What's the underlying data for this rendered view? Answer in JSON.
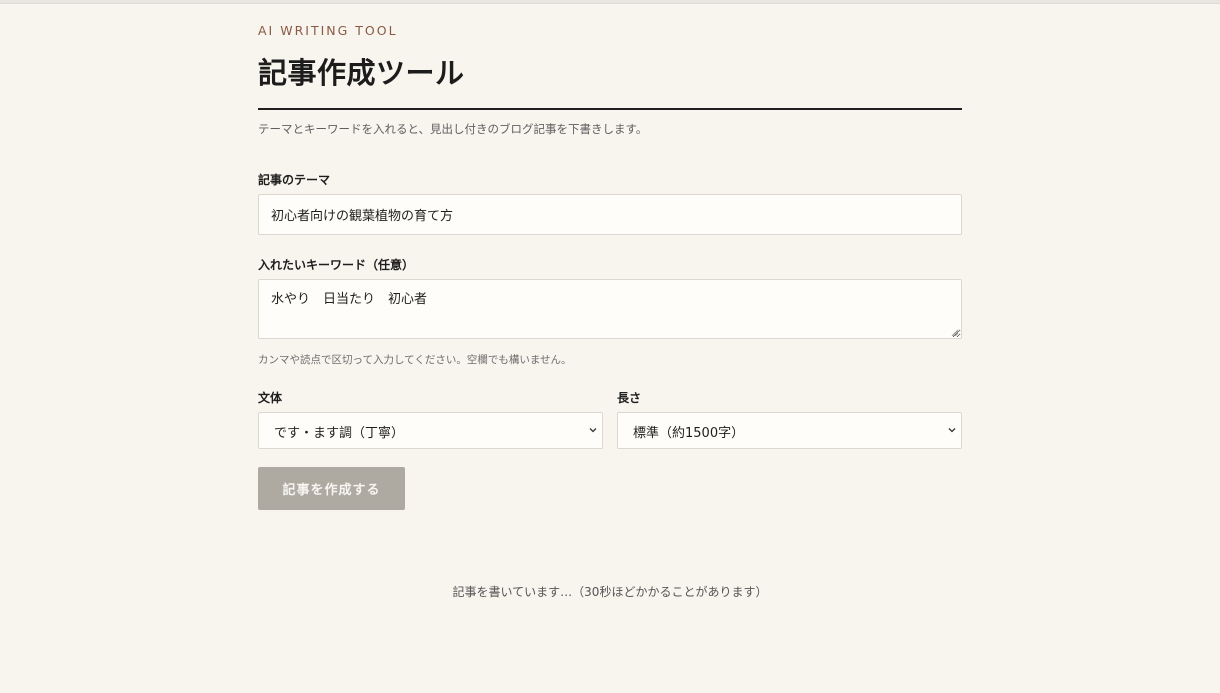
{
  "header": {
    "eyebrow": "AI WRITING TOOL",
    "title": "記事作成ツール",
    "lead": "テーマとキーワードを入れると、見出し付きのブログ記事を下書きします。"
  },
  "form": {
    "theme": {
      "label": "記事のテーマ",
      "value": "初心者向けの観葉植物の育て方"
    },
    "keywords": {
      "label": "入れたいキーワード（任意）",
      "value": "水やり　日当たり　初心者",
      "hint": "カンマや読点で区切って入力してください。空欄でも構いません。"
    },
    "style": {
      "label": "文体",
      "selected": "です・ます調（丁寧）"
    },
    "length": {
      "label": "長さ",
      "selected": "標準（約1500字）"
    },
    "submit_label": "記事を作成する"
  },
  "status": {
    "message": "記事を書いています…（30秒ほどかかることがあります）"
  },
  "colors": {
    "background": "#f8f4ee",
    "accent": "#8a5a44",
    "button_disabled": "#aeaaa1"
  }
}
